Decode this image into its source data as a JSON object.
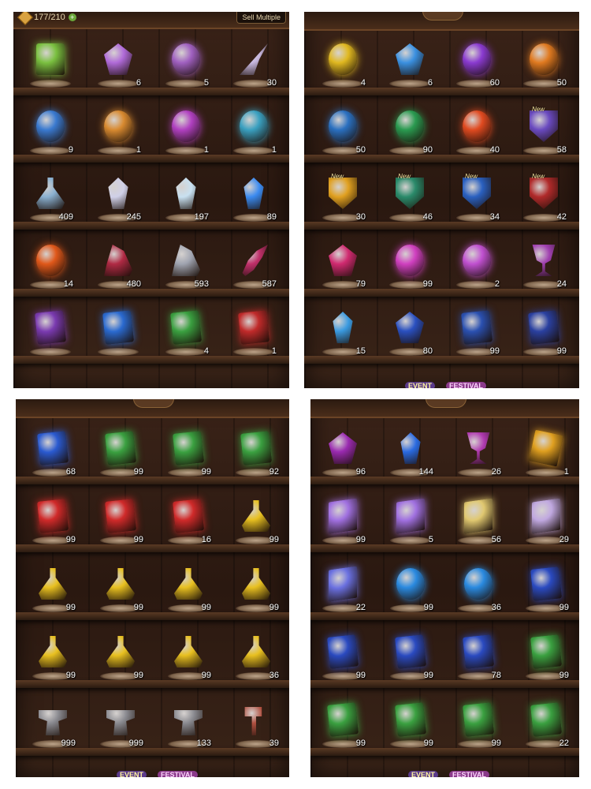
{
  "header": {
    "capacity": "177/210",
    "sell_label": "Sell Multiple",
    "plus": "+"
  },
  "badges": {
    "event": "EVENT",
    "festival": "FESTIVAL"
  },
  "panels": [
    {
      "id": "p1",
      "items": [
        {
          "icon": "spellbook-icon",
          "shape": "book",
          "color": "#7ac040",
          "qty": ""
        },
        {
          "icon": "crystal-star-icon",
          "shape": "gem",
          "color": "#b06ad8",
          "qty": "6"
        },
        {
          "icon": "golden-sigil-icon",
          "shape": "round",
          "color": "#a060c0",
          "qty": "5",
          "stars": "★★★★★"
        },
        {
          "icon": "feather-wing-icon",
          "shape": "wing",
          "color": "#c8b8e0",
          "qty": "30"
        },
        {
          "icon": "water-orb-icon",
          "shape": "round",
          "color": "#3a7ad0",
          "qty": "9"
        },
        {
          "icon": "sun-emblem-icon",
          "shape": "round",
          "color": "#d88a30",
          "qty": "1"
        },
        {
          "icon": "claw-emblem-icon",
          "shape": "round",
          "color": "#b040c0",
          "qty": "1"
        },
        {
          "icon": "ice-emblem-icon",
          "shape": "round",
          "color": "#3aa0c0",
          "qty": "1"
        },
        {
          "icon": "potion-bottle-icon",
          "shape": "flask",
          "color": "#8ab0d0",
          "qty": "409"
        },
        {
          "icon": "ore-shard-icon",
          "shape": "crystal",
          "color": "#d0d0e8",
          "qty": "245"
        },
        {
          "icon": "prism-crystal-icon",
          "shape": "crystal",
          "color": "#c8e0f0",
          "qty": "197"
        },
        {
          "icon": "blue-flame-icon",
          "shape": "crystal",
          "color": "#3a8af0",
          "qty": "89"
        },
        {
          "icon": "fire-rune-icon",
          "shape": "round",
          "color": "#e0581a",
          "qty": "14"
        },
        {
          "icon": "red-boot-icon",
          "shape": "shoe",
          "color": "#b02a44",
          "qty": "480"
        },
        {
          "icon": "silver-blade-icon",
          "shape": "shoe",
          "color": "#a0a4b0",
          "qty": "593"
        },
        {
          "icon": "demon-horn-icon",
          "shape": "horn",
          "color": "#c0306a",
          "qty": "587"
        },
        {
          "icon": "purple-tome-icon",
          "shape": "card",
          "color": "#7a3ab0",
          "qty": "",
          "stars": "★★★★★"
        },
        {
          "icon": "blue-tome-icon",
          "shape": "card",
          "color": "#2a6ad0",
          "qty": "",
          "stars": "★★★★★"
        },
        {
          "icon": "green-tome-icon",
          "shape": "card",
          "color": "#3aa040",
          "qty": "4",
          "stars": "★★★★★"
        },
        {
          "icon": "red-tome-icon",
          "shape": "card",
          "color": "#c02a2a",
          "qty": "1",
          "stars": "★★★★★"
        }
      ]
    },
    {
      "id": "p2",
      "items": [
        {
          "icon": "golden-orb-icon",
          "shape": "round",
          "color": "#e0b820",
          "qty": "4",
          "stars": "★★★★★"
        },
        {
          "icon": "ice-star-icon",
          "shape": "gem",
          "color": "#3a90e0",
          "qty": "6",
          "stars": "★★★★★"
        },
        {
          "icon": "void-swirl-icon",
          "shape": "round",
          "color": "#8a3ad0",
          "qty": "60"
        },
        {
          "icon": "ember-swirl-icon",
          "shape": "round",
          "color": "#e07a20",
          "qty": "50"
        },
        {
          "icon": "wave-emblem-icon",
          "shape": "round",
          "color": "#2a70c0",
          "qty": "50"
        },
        {
          "icon": "skull-emblem-icon",
          "shape": "round",
          "color": "#2a9a50",
          "qty": "90"
        },
        {
          "icon": "fist-emblem-icon",
          "shape": "round",
          "color": "#e04a20",
          "qty": "40"
        },
        {
          "icon": "mystery-shield-icon",
          "shape": "shield",
          "color": "#6a4ac0",
          "qty": "58",
          "new": "New"
        },
        {
          "icon": "gold-crest-icon",
          "shape": "shield",
          "color": "#e0a020",
          "qty": "30",
          "new": "New"
        },
        {
          "icon": "butterfly-crest-icon",
          "shape": "shield",
          "color": "#2a8a6a",
          "qty": "46",
          "new": "New"
        },
        {
          "icon": "azure-crest-icon",
          "shape": "shield",
          "color": "#2a60c0",
          "qty": "34",
          "new": "New"
        },
        {
          "icon": "skull-crest-icon",
          "shape": "shield",
          "color": "#b02a2a",
          "qty": "42",
          "new": "New"
        },
        {
          "icon": "rose-gem-icon",
          "shape": "gem",
          "color": "#d02a70",
          "qty": "79"
        },
        {
          "icon": "rainbow-orb-icon",
          "shape": "round",
          "color": "#d040c0",
          "qty": "99"
        },
        {
          "icon": "spectrum-orb-icon",
          "shape": "round",
          "color": "#c050d0",
          "qty": "2"
        },
        {
          "icon": "royal-chalice-icon",
          "shape": "chalice",
          "color": "#a040b0",
          "qty": "24",
          "stars": "★★★★"
        },
        {
          "icon": "sapphire-shard-icon",
          "shape": "crystal",
          "color": "#3a9ae0",
          "qty": "15"
        },
        {
          "icon": "sapphire-pendant-icon",
          "shape": "gem",
          "color": "#2a50c0",
          "qty": "80"
        },
        {
          "icon": "blue-rune-card-icon",
          "shape": "card",
          "color": "#2a50b0",
          "qty": "99",
          "stars": "★★★★"
        },
        {
          "icon": "indigo-rune-card-icon",
          "shape": "card",
          "color": "#2a40a0",
          "qty": "99",
          "stars": "★★★★"
        }
      ]
    },
    {
      "id": "p3",
      "items": [
        {
          "icon": "blue-card-icon",
          "shape": "card",
          "color": "#2a5ad0",
          "qty": "68",
          "stars": "★★★★"
        },
        {
          "icon": "green-card-icon",
          "shape": "card",
          "color": "#3aa040",
          "qty": "99",
          "stars": "★★★★"
        },
        {
          "icon": "green-card-icon",
          "shape": "card",
          "color": "#3aa040",
          "qty": "99",
          "stars": "★★★★"
        },
        {
          "icon": "green-card-icon",
          "shape": "card",
          "color": "#3aa040",
          "qty": "92",
          "stars": "★★★★"
        },
        {
          "icon": "red-card-icon",
          "shape": "card",
          "color": "#d02a2a",
          "qty": "99",
          "stars": "★★★★"
        },
        {
          "icon": "red-card-icon",
          "shape": "card",
          "color": "#d02a2a",
          "qty": "99",
          "stars": "★★★★"
        },
        {
          "icon": "red-card-icon",
          "shape": "card",
          "color": "#d02a2a",
          "qty": "16",
          "stars": "★★★★"
        },
        {
          "icon": "gold-potion-icon",
          "shape": "flask",
          "color": "#e8c020",
          "qty": "99",
          "stars": "★★★★"
        },
        {
          "icon": "gold-potion-icon",
          "shape": "flask",
          "color": "#e8c020",
          "qty": "99",
          "stars": "★★★★"
        },
        {
          "icon": "gold-potion-icon",
          "shape": "flask",
          "color": "#e8c020",
          "qty": "99",
          "stars": "★★★★"
        },
        {
          "icon": "gold-potion-icon",
          "shape": "flask",
          "color": "#e8c020",
          "qty": "99",
          "stars": "★★★★"
        },
        {
          "icon": "gold-potion-icon",
          "shape": "flask",
          "color": "#e8c020",
          "qty": "99",
          "stars": "★★★★"
        },
        {
          "icon": "gold-potion-icon",
          "shape": "flask",
          "color": "#e8c020",
          "qty": "99",
          "stars": "★★★★"
        },
        {
          "icon": "gold-potion-icon",
          "shape": "flask",
          "color": "#e8c020",
          "qty": "99",
          "stars": "★★★★"
        },
        {
          "icon": "gold-potion-icon",
          "shape": "flask",
          "color": "#e8c020",
          "qty": "99",
          "stars": "★★★★"
        },
        {
          "icon": "gold-potion-icon",
          "shape": "flask",
          "color": "#e8c020",
          "qty": "36",
          "stars": "★★★★"
        },
        {
          "icon": "iron-anvil-icon",
          "shape": "anvil",
          "color": "#8a8a90",
          "qty": "999"
        },
        {
          "icon": "iron-anvil-icon",
          "shape": "anvil",
          "color": "#8a8a90",
          "qty": "999"
        },
        {
          "icon": "iron-anvil-icon",
          "shape": "anvil",
          "color": "#8a8a90",
          "qty": "133"
        },
        {
          "icon": "forge-hammer-icon",
          "shape": "hammer",
          "color": "#b05040",
          "qty": "39"
        }
      ]
    },
    {
      "id": "p4",
      "items": [
        {
          "icon": "amethyst-icon",
          "shape": "gem",
          "color": "#9a2ab0",
          "qty": "96"
        },
        {
          "icon": "sapphire-icon",
          "shape": "crystal",
          "color": "#2a6ae0",
          "qty": "144",
          "stars": "★★★★"
        },
        {
          "icon": "amethyst-chalice-icon",
          "shape": "chalice",
          "color": "#b03ab0",
          "qty": "26",
          "stars": "★★★★"
        },
        {
          "icon": "golden-scroll-icon",
          "shape": "scroll",
          "color": "#e0a020",
          "qty": "1"
        },
        {
          "icon": "violet-cube-icon",
          "shape": "cube",
          "color": "#a070e0",
          "qty": "99"
        },
        {
          "icon": "violet-cube-icon",
          "shape": "cube",
          "color": "#a070e0",
          "qty": "5"
        },
        {
          "icon": "gold-cube-icon",
          "shape": "cube",
          "color": "#e0c870",
          "qty": "56"
        },
        {
          "icon": "lilac-cube-icon",
          "shape": "cube",
          "color": "#c0a8e0",
          "qty": "29"
        },
        {
          "icon": "blue-cube-icon",
          "shape": "cube",
          "color": "#6a70e0",
          "qty": "22"
        },
        {
          "icon": "water-spirit-icon",
          "shape": "round",
          "color": "#2a8ae0",
          "qty": "99"
        },
        {
          "icon": "water-spirit-icon",
          "shape": "round",
          "color": "#2a8ae0",
          "qty": "36"
        },
        {
          "icon": "star-tome-blue-icon",
          "shape": "card",
          "color": "#2a4ac0",
          "qty": "99",
          "stars": "★★★★"
        },
        {
          "icon": "star-tome-blue-icon",
          "shape": "card",
          "color": "#2a4ac0",
          "qty": "99",
          "stars": "★★★★"
        },
        {
          "icon": "star-tome-blue-icon",
          "shape": "card",
          "color": "#2a4ac0",
          "qty": "99",
          "stars": "★★★★"
        },
        {
          "icon": "star-tome-blue-icon",
          "shape": "card",
          "color": "#2a4ac0",
          "qty": "78",
          "stars": "★★★★"
        },
        {
          "icon": "star-tome-green-icon",
          "shape": "card",
          "color": "#3aa040",
          "qty": "99",
          "stars": "★★★★"
        },
        {
          "icon": "star-tome-green-icon",
          "shape": "card",
          "color": "#3aa040",
          "qty": "99",
          "stars": "★★★★"
        },
        {
          "icon": "star-tome-green-icon",
          "shape": "card",
          "color": "#3aa040",
          "qty": "99",
          "stars": "★★★★"
        },
        {
          "icon": "star-tome-green-icon",
          "shape": "card",
          "color": "#3aa040",
          "qty": "99",
          "stars": "★★★★"
        },
        {
          "icon": "star-tome-green-icon",
          "shape": "card",
          "color": "#3aa040",
          "qty": "22",
          "stars": "★★★★"
        }
      ]
    }
  ]
}
